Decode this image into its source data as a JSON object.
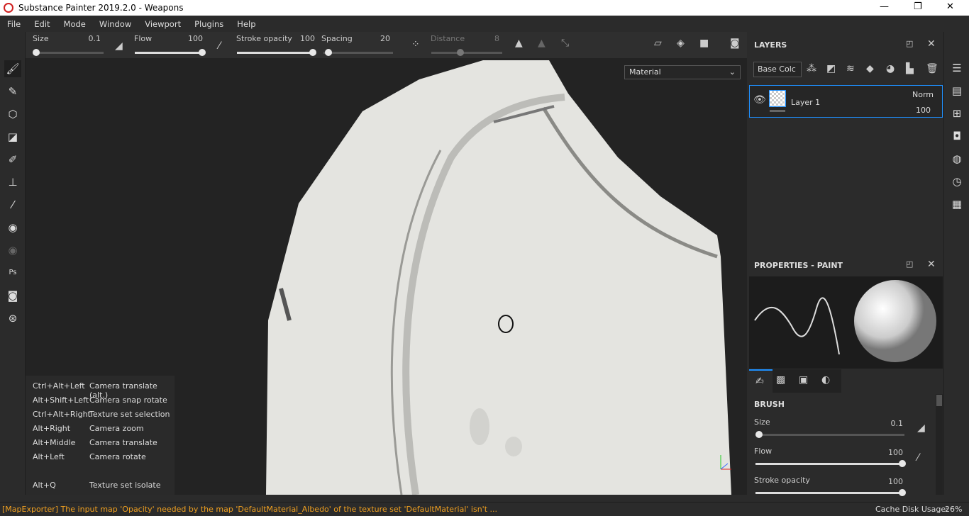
{
  "window": {
    "title": "Substance Painter 2019.2.0 - Weapons",
    "minimize": "—",
    "maximize": "❐",
    "close": "✕"
  },
  "menu": [
    "File",
    "Edit",
    "Mode",
    "Window",
    "Viewport",
    "Plugins",
    "Help"
  ],
  "toolbar": {
    "size": {
      "label": "Size",
      "value": "0.1",
      "fraction": 0.0
    },
    "flow": {
      "label": "Flow",
      "value": "100",
      "fraction": 1.0
    },
    "stroke_opacity": {
      "label": "Stroke opacity",
      "value": "100",
      "fraction": 1.0
    },
    "spacing": {
      "label": "Spacing",
      "value": "20",
      "fraction": 0.04
    },
    "distance": {
      "label": "Distance",
      "value": "8",
      "fraction": 0.4
    }
  },
  "viewport": {
    "material_mode": "Material"
  },
  "shortcuts": [
    {
      "keys": "Ctrl+Alt+Left",
      "action": "Camera translate (alt.)"
    },
    {
      "keys": "Alt+Shift+Left",
      "action": "Camera snap rotate"
    },
    {
      "keys": "Ctrl+Alt+Right",
      "action": "Texture set selection"
    },
    {
      "keys": "Alt+Right",
      "action": "Camera zoom"
    },
    {
      "keys": "Alt+Middle",
      "action": "Camera translate"
    },
    {
      "keys": "Alt+Left",
      "action": "Camera rotate"
    },
    {
      "keys": "Alt+Q",
      "action": "Texture set isolate"
    }
  ],
  "layers": {
    "title": "LAYERS",
    "channel": "Base Colc",
    "items": [
      {
        "name": "Layer 1",
        "blend": "Norm",
        "opacity": "100",
        "visible": true
      }
    ]
  },
  "properties": {
    "title": "PROPERTIES - PAINT",
    "section": "BRUSH",
    "size": {
      "label": "Size",
      "value": "0.1",
      "fraction": 0.0
    },
    "flow": {
      "label": "Flow",
      "value": "100",
      "fraction": 1.0
    },
    "stroke_opacity": {
      "label": "Stroke opacity",
      "value": "100",
      "fraction": 1.0
    }
  },
  "status": {
    "message": "[MapExporter] The input map 'Opacity' needed by the map 'DefaultMaterial_Albedo' of the texture set 'DefaultMaterial' isn't ...",
    "cache_label": "Cache Disk Usage:",
    "cache_value": "26%",
    "message_color": "#f0a020"
  },
  "colors": {
    "accent": "#1e90ff"
  }
}
